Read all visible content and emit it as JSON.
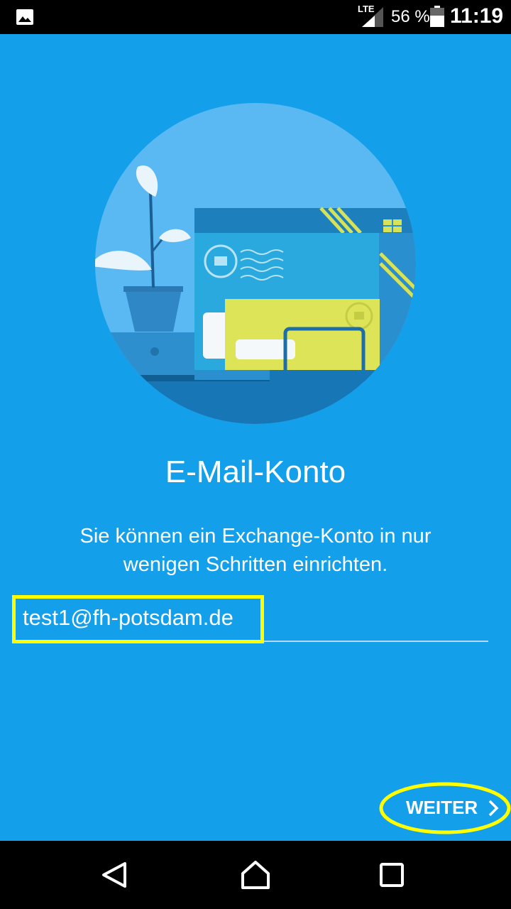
{
  "status_bar": {
    "network": "LTE",
    "battery_percent": "56 %",
    "time": "11:19"
  },
  "content": {
    "title": "E-Mail-Konto",
    "description": "Sie können ein Exchange-Konto in nur wenigen Schritten einrichten.",
    "email_value": "test1@fh-potsdam.de"
  },
  "actions": {
    "next_label": "WEITER"
  },
  "colors": {
    "background": "#139fea",
    "highlight": "#ffff00"
  },
  "icons": {
    "status_image": "image-icon",
    "signal": "signal-icon",
    "battery": "battery-icon",
    "next": "chevron-right-icon",
    "back": "back-icon",
    "home": "home-icon",
    "recents": "recents-icon"
  }
}
